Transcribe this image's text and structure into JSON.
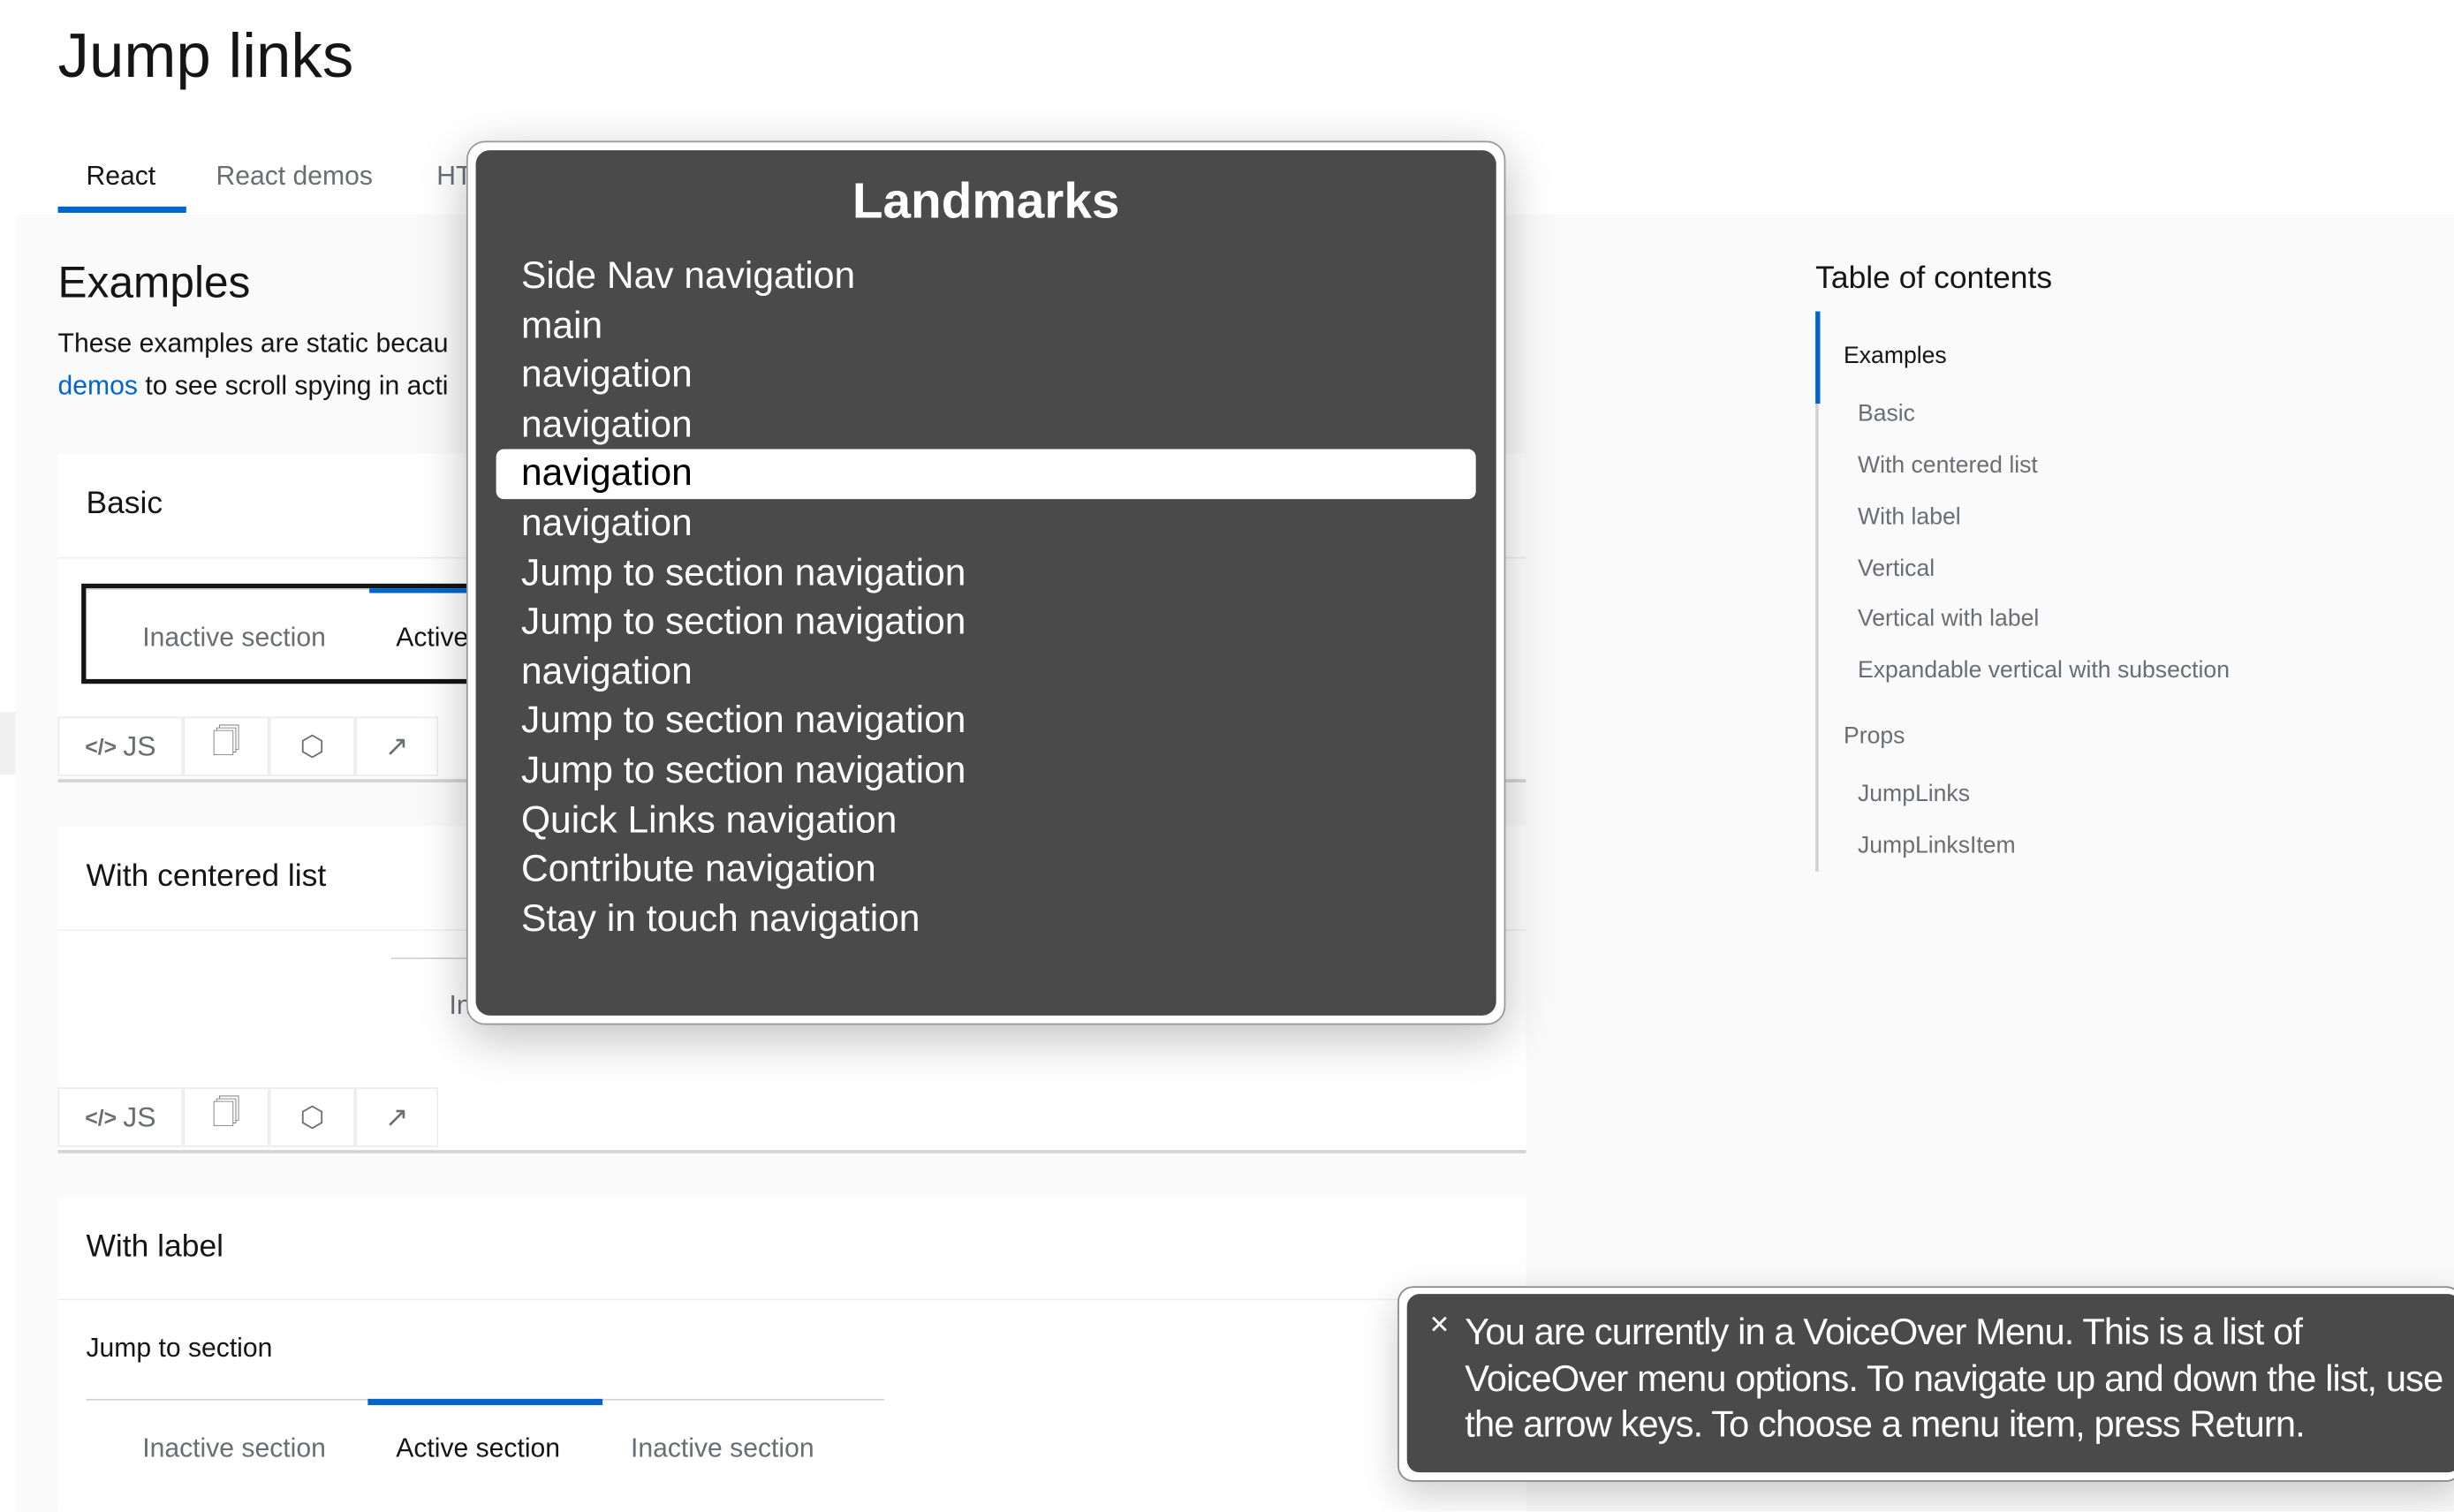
{
  "page": {
    "title": "Jump links"
  },
  "tabs": [
    {
      "label": "React",
      "active": true
    },
    {
      "label": "React demos"
    },
    {
      "label": "HTML"
    }
  ],
  "examples": {
    "heading": "Examples",
    "para_line1": "These examples are static becau",
    "para_link": "demos",
    "para_line2_rest": " to see scroll spying in acti"
  },
  "cards": {
    "basic": {
      "title": "Basic",
      "items": [
        "Inactive section",
        "Active"
      ]
    },
    "centered": {
      "title": "With centered list",
      "partial_item": "In"
    },
    "label": {
      "title": "With label",
      "label": "Jump to section",
      "items": [
        "Inactive section",
        "Active section",
        "Inactive section"
      ]
    }
  },
  "toolbar": {
    "js_label": "JS",
    "icons": [
      "code-icon",
      "copy-icon",
      "codepen-icon",
      "external-link-icon"
    ]
  },
  "toc": {
    "heading": "Table of contents",
    "items": [
      {
        "label": "Examples",
        "active": true
      },
      {
        "label": "Basic"
      },
      {
        "label": "With centered list"
      },
      {
        "label": "With label"
      },
      {
        "label": "Vertical"
      },
      {
        "label": "Vertical with label"
      },
      {
        "label": "Expandable vertical with subsection"
      },
      {
        "label": "Props"
      },
      {
        "label": "JumpLinks"
      },
      {
        "label": "JumpLinksItem"
      }
    ]
  },
  "landmarks": {
    "title": "Landmarks",
    "selected_index": 4,
    "items": [
      "Side Nav navigation",
      "main",
      "navigation",
      "navigation",
      "navigation",
      "navigation",
      "Jump to section navigation",
      "Jump to section navigation",
      "navigation",
      "Jump to section navigation",
      "Jump to section navigation",
      "Quick Links navigation",
      "Contribute navigation",
      "Stay in touch navigation"
    ]
  },
  "voiceover_toast": {
    "text": "You are currently in a VoiceOver Menu. This is a list of VoiceOver menu options. To navigate up and down the list, use the arrow keys. To choose a menu item, press Return."
  },
  "colors": {
    "accent": "#0066cc",
    "overlay_bg": "#4a4a4a",
    "page_bg": "#fafafa"
  }
}
